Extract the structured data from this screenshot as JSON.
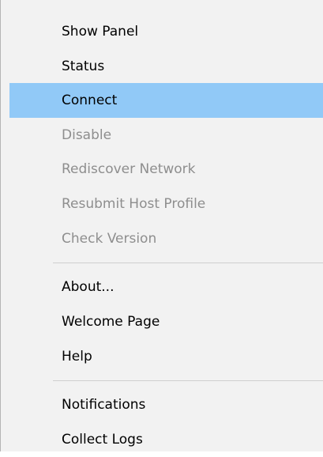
{
  "menu": {
    "items": [
      {
        "label": "Show Panel",
        "state": "enabled"
      },
      {
        "label": "Status",
        "state": "enabled"
      },
      {
        "label": "Connect",
        "state": "highlighted"
      },
      {
        "label": "Disable",
        "state": "disabled"
      },
      {
        "label": "Rediscover Network",
        "state": "disabled"
      },
      {
        "label": "Resubmit Host Profile",
        "state": "disabled"
      },
      {
        "label": "Check Version",
        "state": "disabled"
      },
      {
        "label": "About...",
        "state": "enabled"
      },
      {
        "label": "Welcome Page",
        "state": "enabled"
      },
      {
        "label": "Help",
        "state": "enabled"
      },
      {
        "label": "Notifications",
        "state": "enabled"
      },
      {
        "label": "Collect Logs",
        "state": "enabled"
      }
    ],
    "colors": {
      "background": "#f2f2f2",
      "highlight": "#91c9f7",
      "disabled_text": "#8e8e8e",
      "separator": "#cfcfcf"
    }
  }
}
